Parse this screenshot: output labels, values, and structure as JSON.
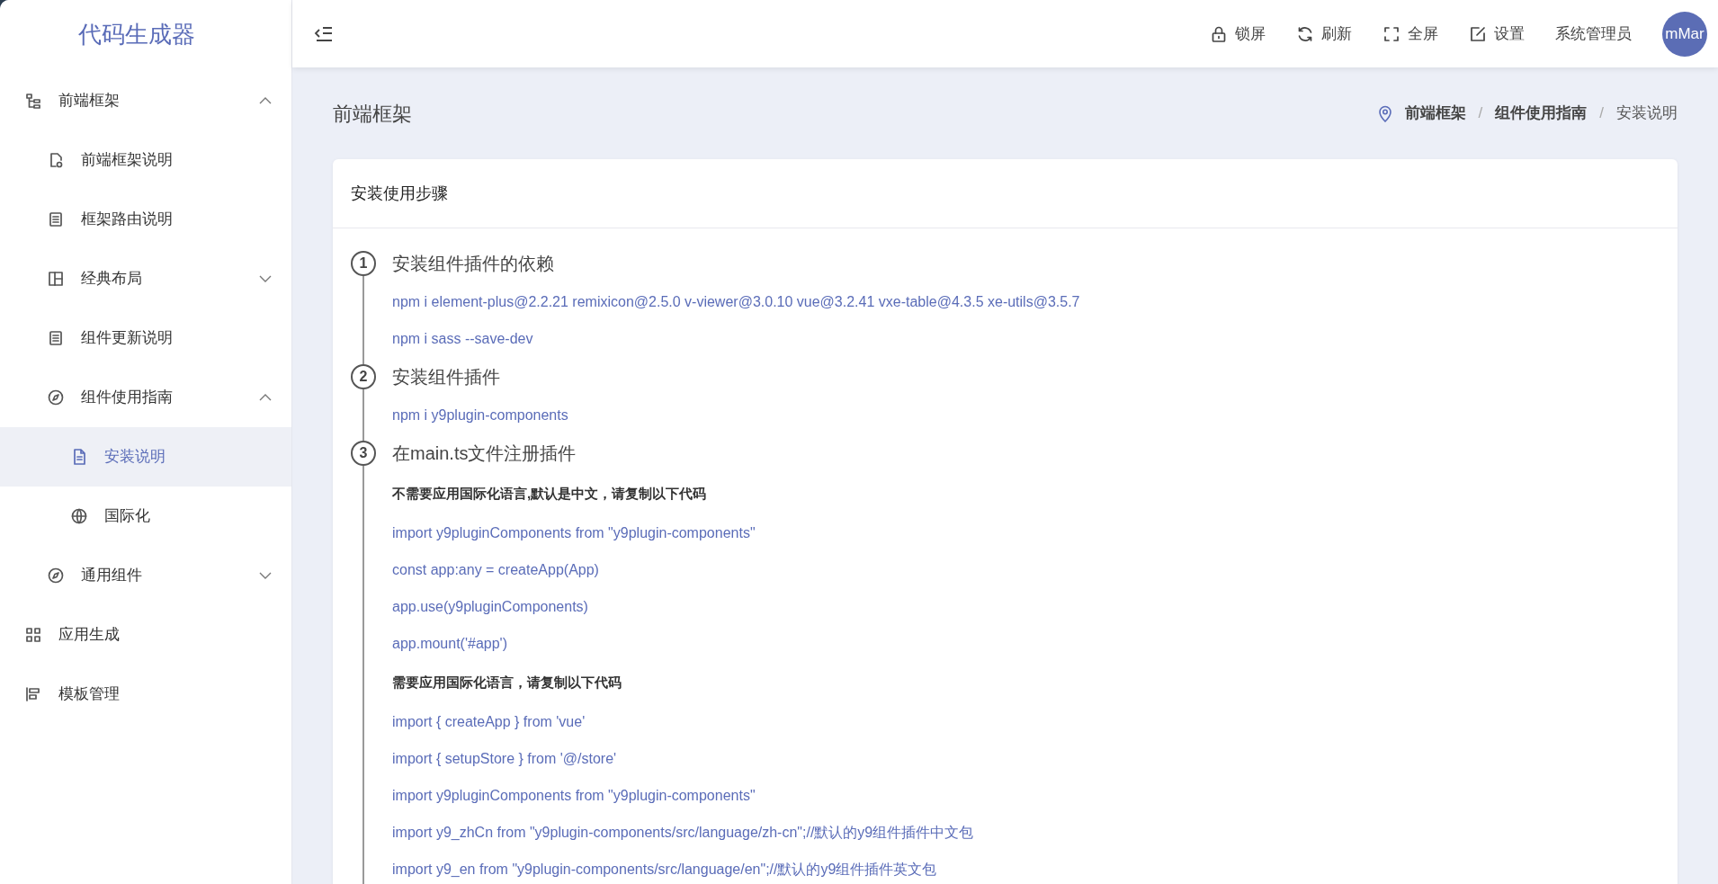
{
  "app": {
    "title": "代码生成器"
  },
  "sidebar": {
    "items": [
      {
        "label": "前端框架",
        "expanded": true,
        "selected": false,
        "children": [
          {
            "label": "前端框架说明",
            "selected": false
          },
          {
            "label": "框架路由说明",
            "selected": false
          },
          {
            "label": "经典布局",
            "expanded": false,
            "selected": false
          },
          {
            "label": "组件更新说明",
            "selected": false
          },
          {
            "label": "组件使用指南",
            "expanded": true,
            "selected": false,
            "children": [
              {
                "label": "安装说明",
                "selected": true
              },
              {
                "label": "国际化",
                "selected": false
              }
            ]
          },
          {
            "label": "通用组件",
            "expanded": false,
            "selected": false
          }
        ]
      },
      {
        "label": "应用生成",
        "selected": false
      },
      {
        "label": "模板管理",
        "selected": false
      }
    ]
  },
  "header": {
    "actions": [
      {
        "label": "锁屏"
      },
      {
        "label": "刷新"
      },
      {
        "label": "全屏"
      },
      {
        "label": "设置"
      }
    ],
    "user": "系统管理员",
    "avatar": "mMar"
  },
  "page": {
    "title": "前端框架",
    "breadcrumb_separators": [
      "/",
      "/"
    ],
    "breadcrumb": [
      {
        "label": "前端框架",
        "current": false
      },
      {
        "label": "组件使用指南",
        "current": false
      },
      {
        "label": "安装说明",
        "current": true
      }
    ]
  },
  "card": {
    "title": "安装使用步骤",
    "steps": [
      {
        "number": "1",
        "title": "安装组件插件的依赖",
        "lines": [
          {
            "kind": "code",
            "text": "npm i element-plus@2.2.21 remixicon@2.5.0 v-viewer@3.0.10 vue@3.2.41 vxe-table@4.3.5 xe-utils@3.5.7"
          },
          {
            "kind": "code",
            "text": "npm i sass --save-dev"
          }
        ]
      },
      {
        "number": "2",
        "title": "安装组件插件",
        "lines": [
          {
            "kind": "code",
            "text": "npm i y9plugin-components"
          }
        ]
      },
      {
        "number": "3",
        "title": "在main.ts文件注册插件",
        "lines": [
          {
            "kind": "note",
            "text": "不需要应用国际化语言,默认是中文，请复制以下代码"
          },
          {
            "kind": "code",
            "text": "import y9pluginComponents from \"y9plugin-components\""
          },
          {
            "kind": "code",
            "text": "const app:any = createApp(App)"
          },
          {
            "kind": "code",
            "text": "app.use(y9pluginComponents)"
          },
          {
            "kind": "code",
            "text": "app.mount('#app')"
          },
          {
            "kind": "note",
            "text": "需要应用国际化语言，请复制以下代码"
          },
          {
            "kind": "code",
            "text": "import { createApp } from 'vue'"
          },
          {
            "kind": "code",
            "text": "import { setupStore } from '@/store'"
          },
          {
            "kind": "code",
            "text": "import y9pluginComponents from \"y9plugin-components\""
          },
          {
            "kind": "code",
            "text": "import y9_zhCn from \"y9plugin-components/src/language/zh-cn\";//默认的y9组件插件中文包"
          },
          {
            "kind": "code",
            "text": "import y9_en from \"y9plugin-components/src/language/en\";//默认的y9组件插件英文包"
          }
        ]
      }
    ]
  }
}
